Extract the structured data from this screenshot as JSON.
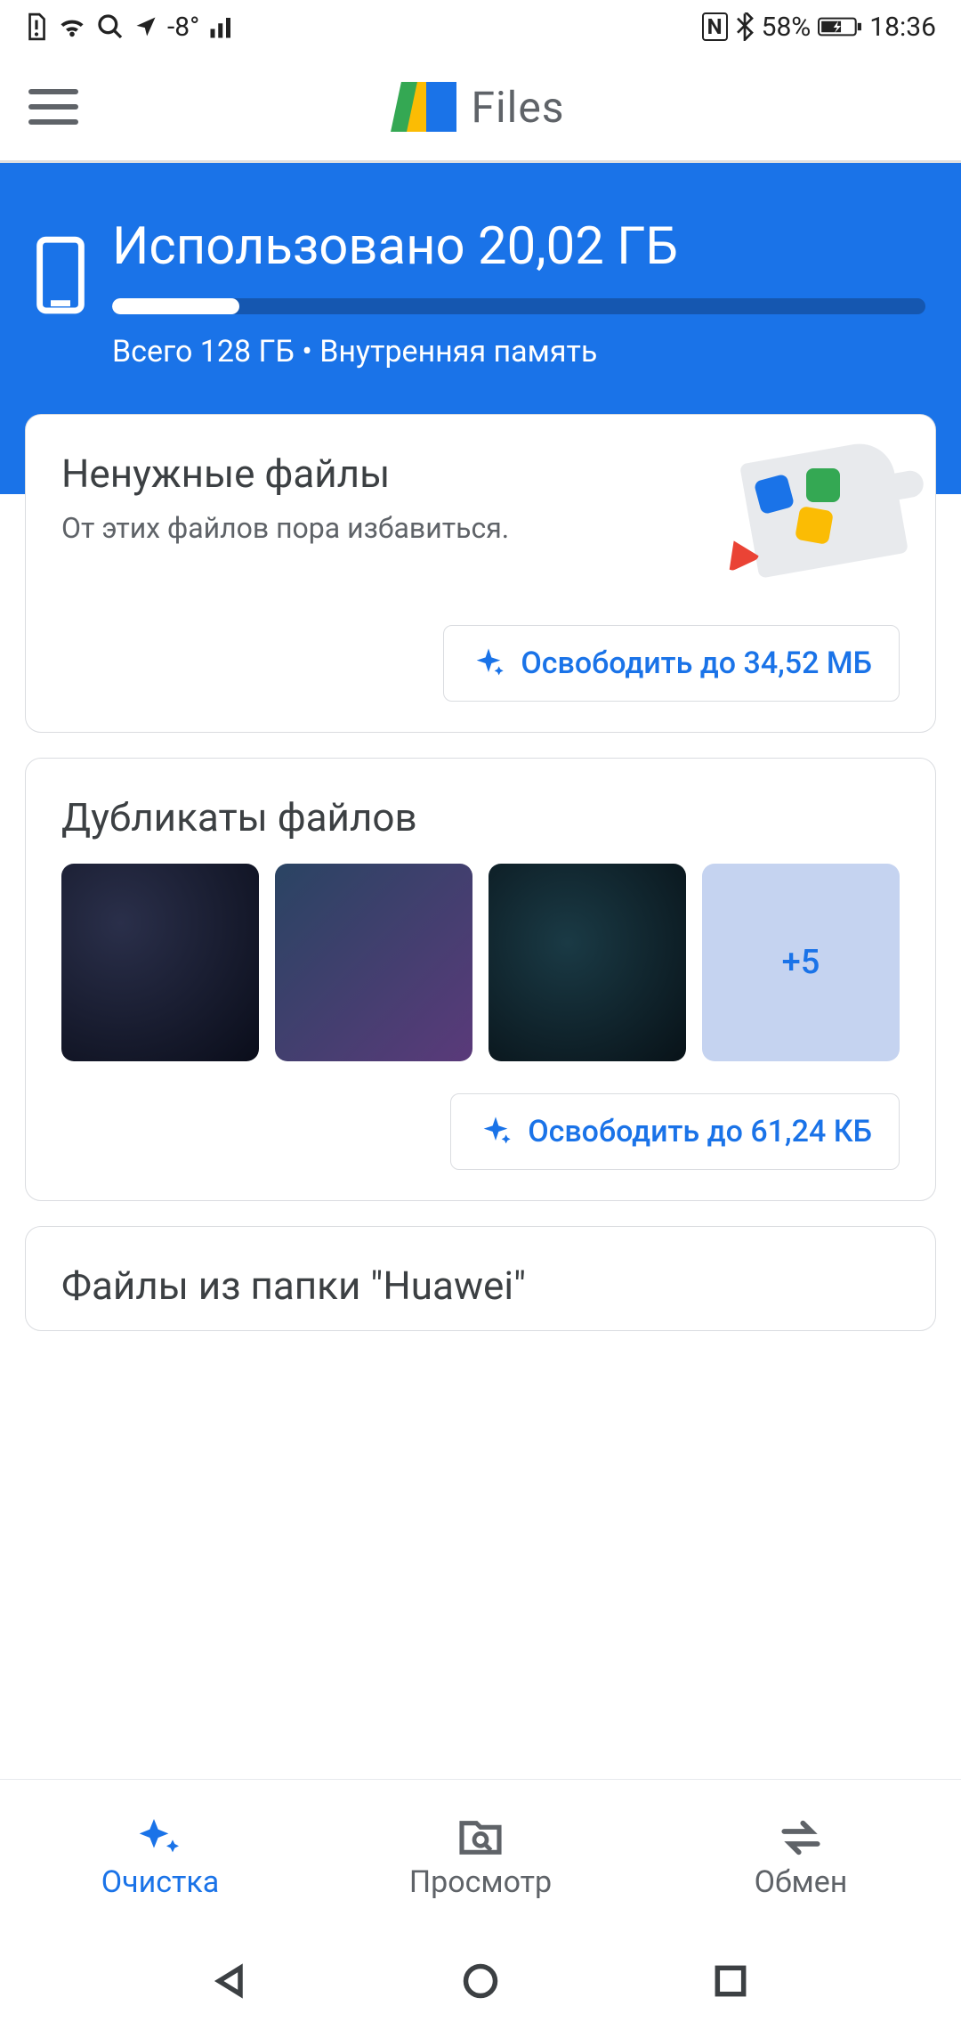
{
  "status": {
    "nfc": "N",
    "battery": "58%",
    "time": "18:36",
    "temp": "-8°"
  },
  "appbar": {
    "title": "Files"
  },
  "storage": {
    "used_label": "Использовано 20,02 ГБ",
    "total_label": "Всего 128 ГБ • Внутренняя память",
    "fill_pct": 15.6
  },
  "cards": {
    "junk": {
      "title": "Ненужные файлы",
      "sub": "От этих файлов пора избавиться.",
      "button": "Освободить до 34,52 МБ"
    },
    "dupes": {
      "title": "Дубликаты файлов",
      "more": "+5",
      "button": "Освободить до 61,24 КБ"
    },
    "huawei": {
      "title": "Файлы из папки \"Huawei\""
    }
  },
  "nav": {
    "clean": "Очистка",
    "browse": "Просмотр",
    "share": "Обмен"
  }
}
